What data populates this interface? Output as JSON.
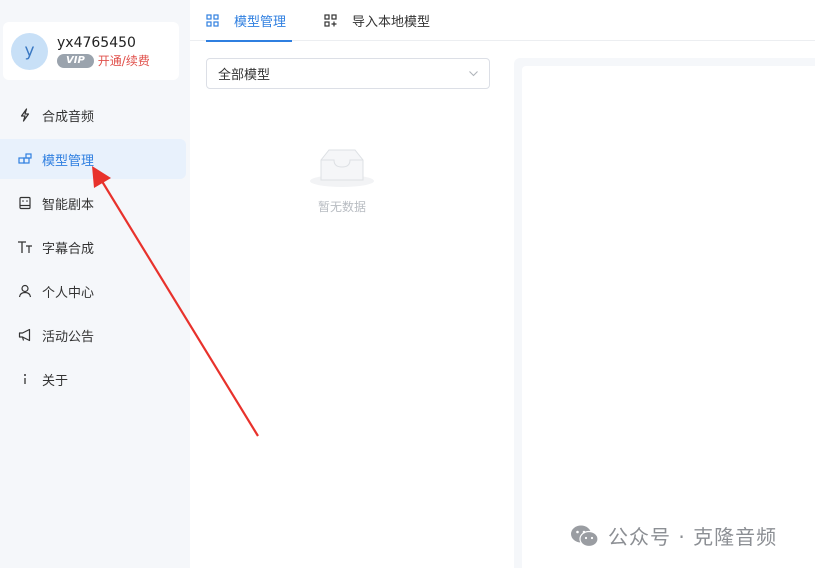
{
  "user": {
    "avatar_letter": "y",
    "username": "yx4765450",
    "vip_badge": "VIP",
    "vip_action": "开通/续费"
  },
  "sidebar": {
    "items": [
      {
        "label": "合成音频",
        "icon": "lightning-icon",
        "active": false
      },
      {
        "label": "模型管理",
        "icon": "blocks-icon",
        "active": true
      },
      {
        "label": "智能剧本",
        "icon": "script-icon",
        "active": false
      },
      {
        "label": "字幕合成",
        "icon": "text-size-icon",
        "active": false
      },
      {
        "label": "个人中心",
        "icon": "user-icon",
        "active": false
      },
      {
        "label": "活动公告",
        "icon": "megaphone-icon",
        "active": false
      },
      {
        "label": "关于",
        "icon": "info-icon",
        "active": false
      }
    ]
  },
  "tabs": [
    {
      "label": "模型管理",
      "icon": "grid-icon",
      "active": true
    },
    {
      "label": "导入本地模型",
      "icon": "import-grid-icon",
      "active": false
    }
  ],
  "filter": {
    "selected": "全部模型"
  },
  "empty_state": {
    "label": "暂无数据"
  },
  "watermark": {
    "text": "公众号 · 克隆音频"
  },
  "colors": {
    "accent": "#2f7fe0",
    "sidebar_bg": "#f5f7fa",
    "active_item_bg": "#e8f1fc",
    "vip_link": "#e0504b",
    "arrow": "#e8322c"
  }
}
